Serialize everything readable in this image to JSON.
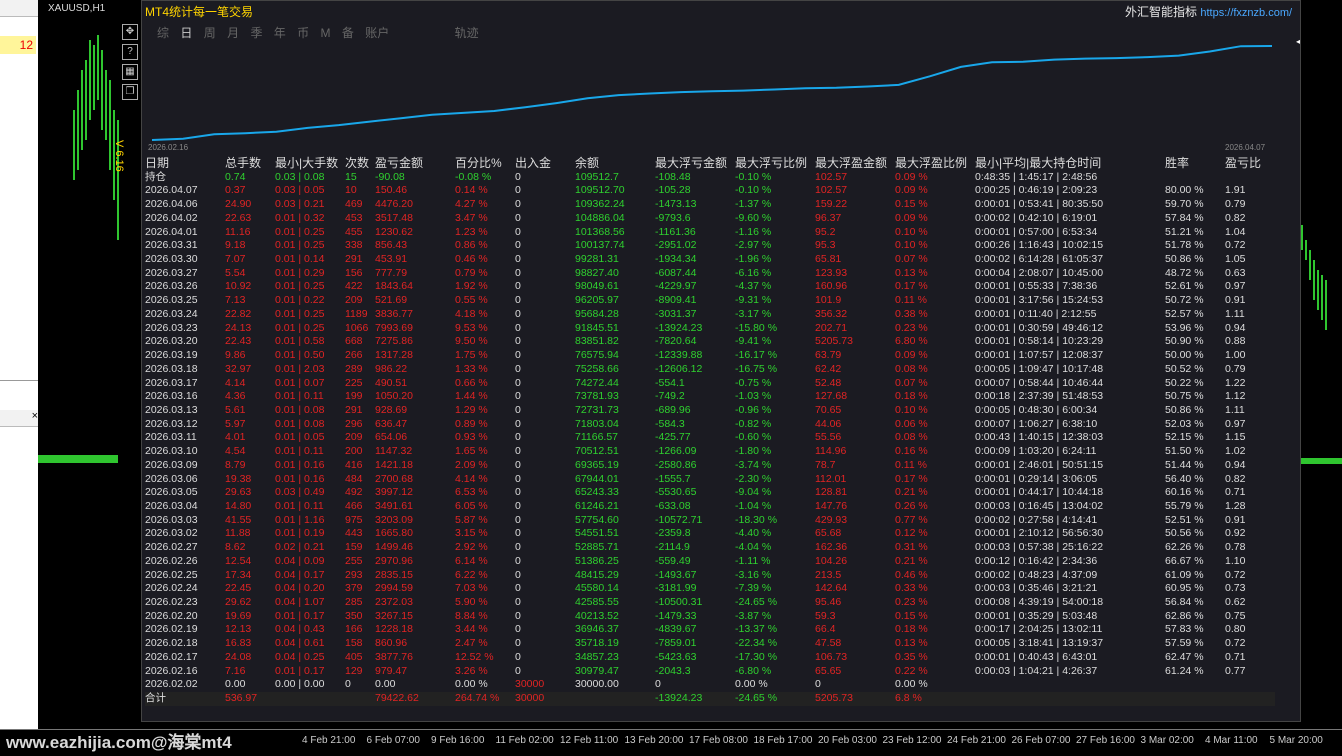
{
  "left_panel": {
    "value": "12",
    "close": "×"
  },
  "chart": {
    "symbol": "XAUUSD,H1",
    "version_tag": "V 6.16"
  },
  "panel": {
    "title": "MT4统计每一笔交易",
    "brand": "外汇智能指标",
    "url": "https://fxznzb.com/",
    "tabs": [
      "综",
      "日",
      "周",
      "月",
      "季",
      "年",
      "币",
      "M",
      "备",
      "账户"
    ],
    "active_tab": "日",
    "track_tab": "轨迹",
    "date_start": "2026.02.16",
    "date_end": "2026.04.07",
    "close": "◂",
    "accent": "#19a7ea"
  },
  "table": {
    "headers": [
      "日期",
      "总手数",
      "最小|大手数",
      "次数",
      "盈亏金额",
      "百分比%",
      "出入金",
      "余额",
      "最大浮亏金额",
      "最大浮亏比例",
      "最大浮盈金额",
      "最大浮盈比例",
      "最小|平均|最大持仓时间",
      "胜率",
      "盈亏比"
    ],
    "holding": [
      "持仓",
      "0.74",
      "0.03 | 0.08",
      "15",
      "-90.08",
      "-0.08 %",
      "0",
      "109512.7",
      "-108.48",
      "-0.10 %",
      "102.57",
      "0.09 %",
      "0:48:35 | 1:45:17 | 2:48:56",
      "",
      ""
    ],
    "rows": [
      [
        "2026.04.07",
        "0.37",
        "0.03 | 0.05",
        "10",
        "150.46",
        "0.14 %",
        "0",
        "109512.70",
        "-105.28",
        "-0.10 %",
        "102.57",
        "0.09 %",
        "0:00:25 | 0:46:19 | 2:09:23",
        "80.00 %",
        "1.91"
      ],
      [
        "2026.04.06",
        "24.90",
        "0.03 | 0.21",
        "469",
        "4476.20",
        "4.27 %",
        "0",
        "109362.24",
        "-1473.13",
        "-1.37 %",
        "159.22",
        "0.15 %",
        "0:00:01 | 0:53:41 | 80:35:50",
        "59.70 %",
        "0.79"
      ],
      [
        "2026.04.02",
        "22.63",
        "0.01 | 0.32",
        "453",
        "3517.48",
        "3.47 %",
        "0",
        "104886.04",
        "-9793.6",
        "-9.60 %",
        "96.37",
        "0.09 %",
        "0:00:02 | 0:42:10 | 6:19:01",
        "57.84 %",
        "0.82"
      ],
      [
        "2026.04.01",
        "11.16",
        "0.01 | 0.25",
        "455",
        "1230.62",
        "1.23 %",
        "0",
        "101368.56",
        "-1161.36",
        "-1.16 %",
        "95.2",
        "0.10 %",
        "0:00:01 | 0:57:00 | 6:53:34",
        "51.21 %",
        "1.04"
      ],
      [
        "2026.03.31",
        "9.18",
        "0.01 | 0.25",
        "338",
        "856.43",
        "0.86 %",
        "0",
        "100137.74",
        "-2951.02",
        "-2.97 %",
        "95.3",
        "0.10 %",
        "0:00:26 | 1:16:43 | 10:02:15",
        "51.78 %",
        "0.72"
      ],
      [
        "2026.03.30",
        "7.07",
        "0.01 | 0.14",
        "291",
        "453.91",
        "0.46 %",
        "0",
        "99281.31",
        "-1934.34",
        "-1.96 %",
        "65.81",
        "0.07 %",
        "0:00:02 | 6:14:28 | 61:05:37",
        "50.86 %",
        "1.05"
      ],
      [
        "2026.03.27",
        "5.54",
        "0.01 | 0.29",
        "156",
        "777.79",
        "0.79 %",
        "0",
        "98827.40",
        "-6087.44",
        "-6.16 %",
        "123.93",
        "0.13 %",
        "0:00:04 | 2:08:07 | 10:45:00",
        "48.72 %",
        "0.63"
      ],
      [
        "2026.03.26",
        "10.92",
        "0.01 | 0.25",
        "422",
        "1843.64",
        "1.92 %",
        "0",
        "98049.61",
        "-4229.97",
        "-4.37 %",
        "160.96",
        "0.17 %",
        "0:00:01 | 0:55:33 | 7:38:36",
        "52.61 %",
        "0.97"
      ],
      [
        "2026.03.25",
        "7.13",
        "0.01 | 0.22",
        "209",
        "521.69",
        "0.55 %",
        "0",
        "96205.97",
        "-8909.41",
        "-9.31 %",
        "101.9",
        "0.11 %",
        "0:00:01 | 3:17:56 | 15:24:53",
        "50.72 %",
        "0.91"
      ],
      [
        "2026.03.24",
        "22.82",
        "0.01 | 0.25",
        "1189",
        "3836.77",
        "4.18 %",
        "0",
        "95684.28",
        "-3031.37",
        "-3.17 %",
        "356.32",
        "0.38 %",
        "0:00:01 | 0:11:40 | 2:12:55",
        "52.57 %",
        "1.11"
      ],
      [
        "2026.03.23",
        "24.13",
        "0.01 | 0.25",
        "1066",
        "7993.69",
        "9.53 %",
        "0",
        "91845.51",
        "-13924.23",
        "-15.80 %",
        "202.71",
        "0.23 %",
        "0:00:01 | 0:30:59 | 49:46:12",
        "53.96 %",
        "0.94"
      ],
      [
        "2026.03.20",
        "22.43",
        "0.01 | 0.58",
        "668",
        "7275.86",
        "9.50 %",
        "0",
        "83851.82",
        "-7820.64",
        "-9.41 %",
        "5205.73",
        "6.80 %",
        "0:00:01 | 0:58:14 | 10:23:29",
        "50.90 %",
        "0.88"
      ],
      [
        "2026.03.19",
        "9.86",
        "0.01 | 0.50",
        "266",
        "1317.28",
        "1.75 %",
        "0",
        "76575.94",
        "-12339.88",
        "-16.17 %",
        "63.79",
        "0.09 %",
        "0:00:01 | 1:07:57 | 12:08:37",
        "50.00 %",
        "1.00"
      ],
      [
        "2026.03.18",
        "32.97",
        "0.01 | 2.03",
        "289",
        "986.22",
        "1.33 %",
        "0",
        "75258.66",
        "-12606.12",
        "-16.75 %",
        "62.42",
        "0.08 %",
        "0:00:05 | 1:09:47 | 10:17:48",
        "50.52 %",
        "0.79"
      ],
      [
        "2026.03.17",
        "4.14",
        "0.01 | 0.07",
        "225",
        "490.51",
        "0.66 %",
        "0",
        "74272.44",
        "-554.1",
        "-0.75 %",
        "52.48",
        "0.07 %",
        "0:00:07 | 0:58:44 | 10:46:44",
        "50.22 %",
        "1.22"
      ],
      [
        "2026.03.16",
        "4.36",
        "0.01 | 0.11",
        "199",
        "1050.20",
        "1.44 %",
        "0",
        "73781.93",
        "-749.2",
        "-1.03 %",
        "127.68",
        "0.18 %",
        "0:00:18 | 2:37:39 | 51:48:53",
        "50.75 %",
        "1.12"
      ],
      [
        "2026.03.13",
        "5.61",
        "0.01 | 0.08",
        "291",
        "928.69",
        "1.29 %",
        "0",
        "72731.73",
        "-689.96",
        "-0.96 %",
        "70.65",
        "0.10 %",
        "0:00:05 | 0:48:30 | 6:00:34",
        "50.86 %",
        "1.11"
      ],
      [
        "2026.03.12",
        "5.97",
        "0.01 | 0.08",
        "296",
        "636.47",
        "0.89 %",
        "0",
        "71803.04",
        "-584.3",
        "-0.82 %",
        "44.06",
        "0.06 %",
        "0:00:07 | 1:06:27 | 6:38:10",
        "52.03 %",
        "0.97"
      ],
      [
        "2026.03.11",
        "4.01",
        "0.01 | 0.05",
        "209",
        "654.06",
        "0.93 %",
        "0",
        "71166.57",
        "-425.77",
        "-0.60 %",
        "55.56",
        "0.08 %",
        "0:00:43 | 1:40:15 | 12:38:03",
        "52.15 %",
        "1.15"
      ],
      [
        "2026.03.10",
        "4.54",
        "0.01 | 0.11",
        "200",
        "1147.32",
        "1.65 %",
        "0",
        "70512.51",
        "-1266.09",
        "-1.80 %",
        "114.96",
        "0.16 %",
        "0:00:09 | 1:03:20 | 6:24:11",
        "51.50 %",
        "1.02"
      ],
      [
        "2026.03.09",
        "8.79",
        "0.01 | 0.16",
        "416",
        "1421.18",
        "2.09 %",
        "0",
        "69365.19",
        "-2580.86",
        "-3.74 %",
        "78.7",
        "0.11 %",
        "0:00:01 | 2:46:01 | 50:51:15",
        "51.44 %",
        "0.94"
      ],
      [
        "2026.03.06",
        "19.38",
        "0.01 | 0.16",
        "484",
        "2700.68",
        "4.14 %",
        "0",
        "67944.01",
        "-1555.7",
        "-2.30 %",
        "112.01",
        "0.17 %",
        "0:00:01 | 0:29:14 | 3:06:05",
        "56.40 %",
        "0.82"
      ],
      [
        "2026.03.05",
        "29.63",
        "0.03 | 0.49",
        "492",
        "3997.12",
        "6.53 %",
        "0",
        "65243.33",
        "-5530.65",
        "-9.04 %",
        "128.81",
        "0.21 %",
        "0:00:01 | 0:44:17 | 10:44:18",
        "60.16 %",
        "0.71"
      ],
      [
        "2026.03.04",
        "14.80",
        "0.01 | 0.11",
        "466",
        "3491.61",
        "6.05 %",
        "0",
        "61246.21",
        "-633.08",
        "-1.04 %",
        "147.76",
        "0.26 %",
        "0:00:03 | 0:16:45 | 13:04:02",
        "55.79 %",
        "1.28"
      ],
      [
        "2026.03.03",
        "41.55",
        "0.01 | 1.16",
        "975",
        "3203.09",
        "5.87 %",
        "0",
        "57754.60",
        "-10572.71",
        "-18.30 %",
        "429.93",
        "0.77 %",
        "0:00:02 | 0:27:58 | 4:14:41",
        "52.51 %",
        "0.91"
      ],
      [
        "2026.03.02",
        "11.88",
        "0.01 | 0.19",
        "443",
        "1665.80",
        "3.15 %",
        "0",
        "54551.51",
        "-2359.8",
        "-4.40 %",
        "65.68",
        "0.12 %",
        "0:00:01 | 2:10:12 | 56:56:30",
        "50.56 %",
        "0.92"
      ],
      [
        "2026.02.27",
        "8.62",
        "0.02 | 0.21",
        "159",
        "1499.46",
        "2.92 %",
        "0",
        "52885.71",
        "-2114.9",
        "-4.04 %",
        "162.36",
        "0.31 %",
        "0:00:03 | 0:57:38 | 25:16:22",
        "62.26 %",
        "0.78"
      ],
      [
        "2026.02.26",
        "12.54",
        "0.04 | 0.09",
        "255",
        "2970.96",
        "6.14 %",
        "0",
        "51386.25",
        "-559.49",
        "-1.11 %",
        "104.26",
        "0.21 %",
        "0:00:12 | 0:16:42 | 2:34:36",
        "66.67 %",
        "1.10"
      ],
      [
        "2026.02.25",
        "17.34",
        "0.04 | 0.17",
        "293",
        "2835.15",
        "6.22 %",
        "0",
        "48415.29",
        "-1493.67",
        "-3.16 %",
        "213.5",
        "0.46 %",
        "0:00:02 | 0:48:23 | 4:37:09",
        "61.09 %",
        "0.72"
      ],
      [
        "2026.02.24",
        "22.45",
        "0.04 | 0.20",
        "379",
        "2994.59",
        "7.03 %",
        "0",
        "45580.14",
        "-3181.99",
        "-7.39 %",
        "142.64",
        "0.33 %",
        "0:00:03 | 0:35:46 | 3:21:21",
        "60.95 %",
        "0.73"
      ],
      [
        "2026.02.23",
        "29.62",
        "0.04 | 1.07",
        "285",
        "2372.03",
        "5.90 %",
        "0",
        "42585.55",
        "-10500.31",
        "-24.65 %",
        "95.46",
        "0.23 %",
        "0:00:08 | 4:39:19 | 54:00:18",
        "56.84 %",
        "0.62"
      ],
      [
        "2026.02.20",
        "19.69",
        "0.01 | 0.17",
        "350",
        "3267.15",
        "8.84 %",
        "0",
        "40213.52",
        "-1479.33",
        "-3.87 %",
        "59.3",
        "0.15 %",
        "0:00:01 | 0:35:29 | 5:03:48",
        "62.86 %",
        "0.75"
      ],
      [
        "2026.02.19",
        "12.13",
        "0.04 | 0.43",
        "166",
        "1228.18",
        "3.44 %",
        "0",
        "36946.37",
        "-4839.67",
        "-13.37 %",
        "66.4",
        "0.18 %",
        "0:00:17 | 2:04:25 | 13:02:11",
        "57.83 %",
        "0.80"
      ],
      [
        "2026.02.18",
        "16.83",
        "0.04 | 0.61",
        "158",
        "860.96",
        "2.47 %",
        "0",
        "35718.19",
        "-7859.01",
        "-22.34 %",
        "47.58",
        "0.13 %",
        "0:00:05 | 3:18:41 | 13:19:37",
        "57.59 %",
        "0.72"
      ],
      [
        "2026.02.17",
        "24.08",
        "0.04 | 0.25",
        "405",
        "3877.76",
        "12.52 %",
        "0",
        "34857.23",
        "-5423.63",
        "-17.30 %",
        "106.73",
        "0.35 %",
        "0:00:01 | 0:40:43 | 6:43:01",
        "62.47 %",
        "0.71"
      ],
      [
        "2026.02.16",
        "7.16",
        "0.01 | 0.17",
        "129",
        "979.47",
        "3.26 %",
        "0",
        "30979.47",
        "-2043.3",
        "-6.80 %",
        "65.65",
        "0.22 %",
        "0:00:03 | 1:04:21 | 4:26:37",
        "61.24 %",
        "0.77"
      ],
      [
        "2026.02.02",
        "0.00",
        "0.00 | 0.00",
        "0",
        "0.00",
        "0.00 %",
        "30000",
        "30000.00",
        "0",
        "0.00 %",
        "0",
        "0.00 %",
        "",
        "",
        ""
      ]
    ],
    "total": [
      "合计",
      "536.97",
      "",
      "",
      "79422.62",
      "264.74 %",
      "30000",
      "",
      "-13924.23",
      "-24.65 %",
      "5205.73",
      "6.8 %",
      "",
      "",
      ""
    ]
  },
  "equity_curve": [
    30000,
    30979.47,
    34857.23,
    35718.19,
    36946.37,
    40213.52,
    42585.55,
    45580.14,
    48415.29,
    51386.25,
    52885.71,
    54551.51,
    57754.6,
    61246.21,
    65243.33,
    67944.01,
    69365.19,
    70512.51,
    71166.57,
    71803.04,
    72731.73,
    73781.93,
    74272.44,
    75258.66,
    76575.94,
    83851.82,
    91845.51,
    95684.28,
    96205.97,
    98049.61,
    98827.4,
    99281.31,
    100137.74,
    101368.56,
    104886.04,
    109362.24,
    109512.7
  ],
  "time_axis": [
    "4 Feb 21:00",
    "6 Feb 07:00",
    "9 Feb 16:00",
    "11 Feb 02:00",
    "12 Feb 11:00",
    "13 Feb 20:00",
    "17 Feb 08:00",
    "18 Feb 17:00",
    "20 Feb 03:00",
    "23 Feb 12:00",
    "24 Feb 21:00",
    "26 Feb 07:00",
    "27 Feb 16:00",
    "3 Mar 02:00",
    "4 Mar 11:00",
    "5 Mar 20:00"
  ],
  "watermark": "www.eazhijia.com@海棠mt4"
}
